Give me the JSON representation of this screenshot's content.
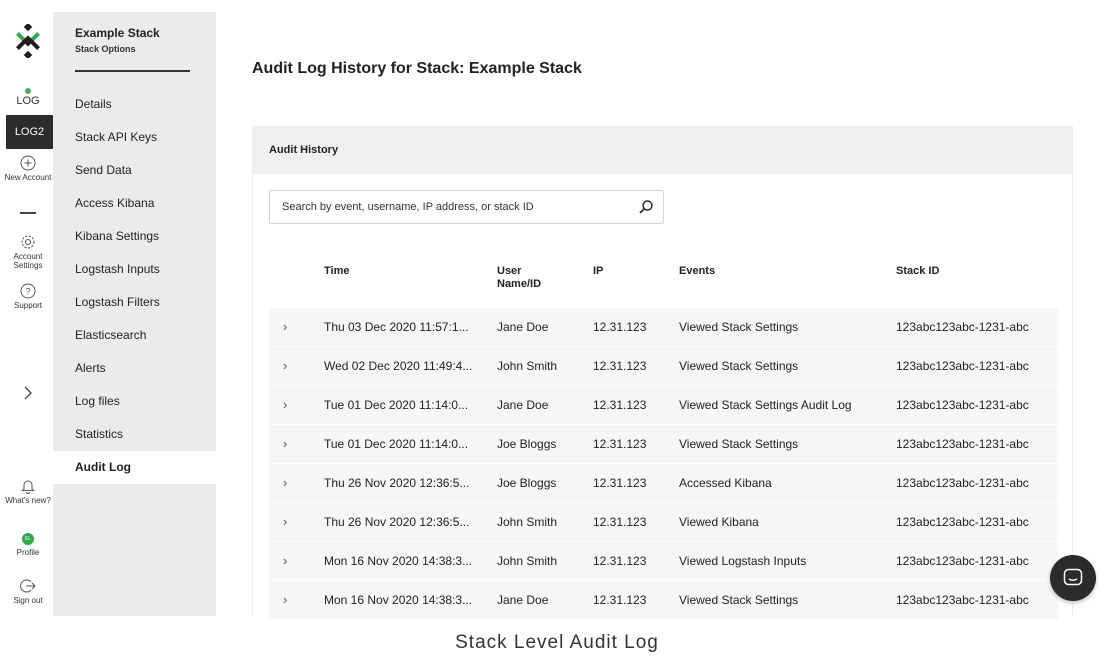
{
  "rail": {
    "log_label": "LOG",
    "log2_label": "LOG2",
    "new_account": "New Account",
    "account_settings": "Account Settings",
    "support": "Support",
    "whats_new": "What's new?",
    "avatar_initials": "EL",
    "profile": "Profile",
    "sign_out": "Sign out"
  },
  "sidebar": {
    "title": "Example Stack",
    "subtitle": "Stack Options",
    "items": [
      {
        "label": "Details"
      },
      {
        "label": "Stack API Keys"
      },
      {
        "label": "Send Data"
      },
      {
        "label": "Access Kibana"
      },
      {
        "label": "Kibana Settings"
      },
      {
        "label": "Logstash Inputs"
      },
      {
        "label": "Logstash Filters"
      },
      {
        "label": "Elasticsearch"
      },
      {
        "label": "Alerts"
      },
      {
        "label": "Log files"
      },
      {
        "label": "Statistics"
      },
      {
        "label": "Audit Log"
      }
    ],
    "active_index": 11
  },
  "main": {
    "page_title": "Audit Log History for Stack: Example Stack",
    "panel_title": "Audit History",
    "search_placeholder": "Search by event, username, IP address, or stack ID",
    "columns": {
      "time": "Time",
      "user_line1": "User",
      "user_line2": "Name/ID",
      "ip": "IP",
      "events": "Events",
      "stack_id": "Stack ID"
    },
    "rows": [
      {
        "time": "Thu 03 Dec 2020 11:57:1...",
        "user": "Jane Doe",
        "ip": "12.31.123",
        "event": "Viewed Stack Settings",
        "stack_id": "123abc123abc-1231-abc"
      },
      {
        "time": "Wed 02 Dec 2020 11:49:4...",
        "user": "John Smith",
        "ip": "12.31.123",
        "event": "Viewed Stack Settings",
        "stack_id": "123abc123abc-1231-abc"
      },
      {
        "time": "Tue 01 Dec 2020 11:14:0...",
        "user": "Jane Doe",
        "ip": "12.31.123",
        "event": "Viewed Stack Settings Audit Log",
        "stack_id": "123abc123abc-1231-abc"
      },
      {
        "time": "Tue 01 Dec 2020 11:14:0...",
        "user": "Joe Bloggs",
        "ip": "12.31.123",
        "event": "Viewed Stack Settings",
        "stack_id": "123abc123abc-1231-abc"
      },
      {
        "time": "Thu 26 Nov 2020 12:36:5...",
        "user": "Joe Bloggs",
        "ip": "12.31.123",
        "event": "Accessed Kibana",
        "stack_id": "123abc123abc-1231-abc"
      },
      {
        "time": "Thu 26 Nov 2020 12:36:5...",
        "user": "John Smith",
        "ip": "12.31.123",
        "event": "Viewed Kibana",
        "stack_id": "123abc123abc-1231-abc"
      },
      {
        "time": "Mon 16 Nov 2020 14:38:3...",
        "user": "John Smith",
        "ip": "12.31.123",
        "event": "Viewed Logstash Inputs",
        "stack_id": "123abc123abc-1231-abc"
      },
      {
        "time": "Mon 16 Nov 2020 14:38:3...",
        "user": "Jane Doe",
        "ip": "12.31.123",
        "event": "Viewed Stack Settings",
        "stack_id": "123abc123abc-1231-abc"
      }
    ]
  },
  "caption": "Stack Level Audit Log",
  "colors": {
    "accent_green": "#2eaa4a",
    "dark": "#2b2b2b",
    "sidebar_bg": "#ebebeb"
  },
  "icons": {
    "logo": "logo-icon",
    "new_account": "plus-circle-icon",
    "account_settings": "gear-icon",
    "support": "question-circle-icon",
    "expand_rail": "chevron-right-icon",
    "whats_new": "bell-icon",
    "sign_out": "sign-out-icon",
    "search": "search-icon",
    "row_expand": "chevron-right-icon",
    "chat": "chat-bubble-icon"
  }
}
